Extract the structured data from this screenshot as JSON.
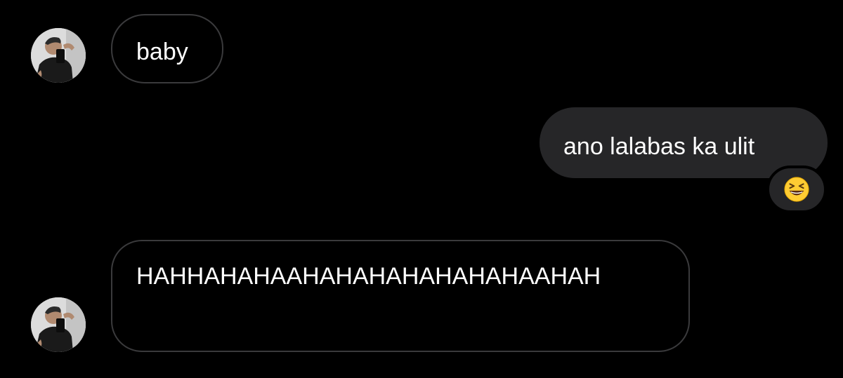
{
  "conversation": {
    "messages": [
      {
        "sender": "other",
        "text": "baby"
      },
      {
        "sender": "me",
        "text": "ano lalabas ka ulit",
        "reaction": "grinning-squinting-face-emoji"
      },
      {
        "sender": "other",
        "text": "HAHHAHAHAAHAHAHAHAHAHAHAAHAH"
      }
    ]
  },
  "colors": {
    "background": "#000000",
    "incoming_border": "#3a3a3c",
    "outgoing_bubble": "#262628",
    "text": "#ffffff",
    "emoji_yellow": "#ffcc33"
  }
}
